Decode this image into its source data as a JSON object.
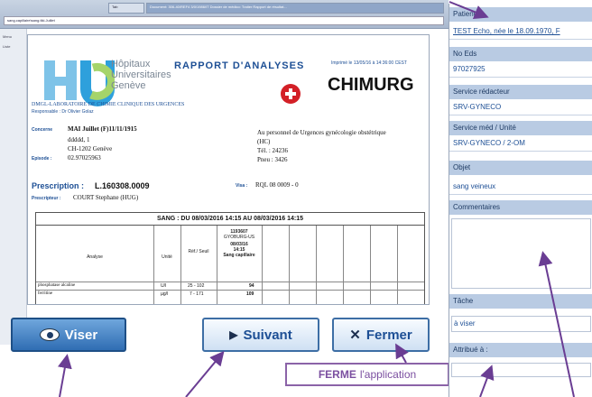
{
  "browser": {
    "address": "sang.capillaire\\sang.tiki.Juillet",
    "tab_small": "Tab",
    "tab_main": "Document: 306-40/REF4 3/0/1986/IT Dossier de médico: Traiter Rapport de résultat..."
  },
  "left_rail": {
    "items": [
      "Menu",
      "Liste"
    ]
  },
  "report": {
    "hopitaux_lines": [
      "Hôpitaux",
      "Universitaires",
      "Genève"
    ],
    "title": "RAPPORT D'ANALYSES",
    "printed": "Imprimé le 13/05/16 à 14:36:00 CEST",
    "service_code": "CHIMURG",
    "labo": "DMGL-LABORATOIRE DE CHIMIE CLINIQUE DES URGENCES",
    "responsable": "Responsable : Dr Olivier Golaz",
    "concerne_label": "Concerne",
    "patient_name": "MAI Juillet (F)11/11/1915",
    "address1": "ddddd, 1",
    "address2": "CH-1202 Genève",
    "episode_label": "Episode :",
    "episode": "02.97025963",
    "dest1": "Au personnel de Urgences gynécologie obstétrique",
    "dest2": "(HC)",
    "tel": "Tél. : 24236",
    "pneu": "Pneu : 3426",
    "prescription_label": "Prescription :",
    "prescription_num": "L.160308.0009",
    "visa_label": "Visa :",
    "visa": "RQL 08 0009 - 0",
    "prescripteur_label": "Prescripteur :",
    "prescripteur": "COURT Stephane (HUG)",
    "band": "SANG : DU 08/03/2016 14:15 AU 08/03/2016 14:15",
    "headers": {
      "analyse": "Analyse",
      "unite": "Unité",
      "ref": "Réf./ Seuil",
      "sample_lines": [
        "1193607",
        "GYOBURG-US",
        "08/03/16",
        "14:15",
        "Sang capillaire"
      ]
    },
    "rows": [
      {
        "analyse": "phosphatase alcaline",
        "unite": "U/l",
        "ref": "25 - 102",
        "value": "94"
      },
      {
        "analyse": "ferritine",
        "unite": "µg/l",
        "ref": "7 - 171",
        "value": "109"
      }
    ]
  },
  "buttons": {
    "viser": "Viser",
    "suivant": "Suivant",
    "fermer": "Fermer"
  },
  "annotation": {
    "ferme_bold": "FERME",
    "ferme_rest": "l'application"
  },
  "panel": {
    "patient_label": "Patient",
    "patient_value": "TEST Echo, née le 18.09.1970, F",
    "no_eds_label": "No Eds",
    "no_eds_value": "97027925",
    "service_redacteur_label": "Service rédacteur",
    "service_redacteur_value": "SRV-GYNECO",
    "service_med_label": "Service méd / Unité",
    "service_med_value": "SRV-GYNECO / 2-OM",
    "objet_label": "Objet",
    "objet_value": "sang veineux",
    "commentaires_label": "Commentaires",
    "commentaires_value": "",
    "tache_label": "Tâche",
    "tache_value": "à viser",
    "attribue_label": "Attribué à :",
    "attribue_value": ""
  },
  "colors": {
    "accent": "#1d4f95",
    "panel_label_bg": "#b9cbe3",
    "annotation": "#7b4fa0"
  }
}
